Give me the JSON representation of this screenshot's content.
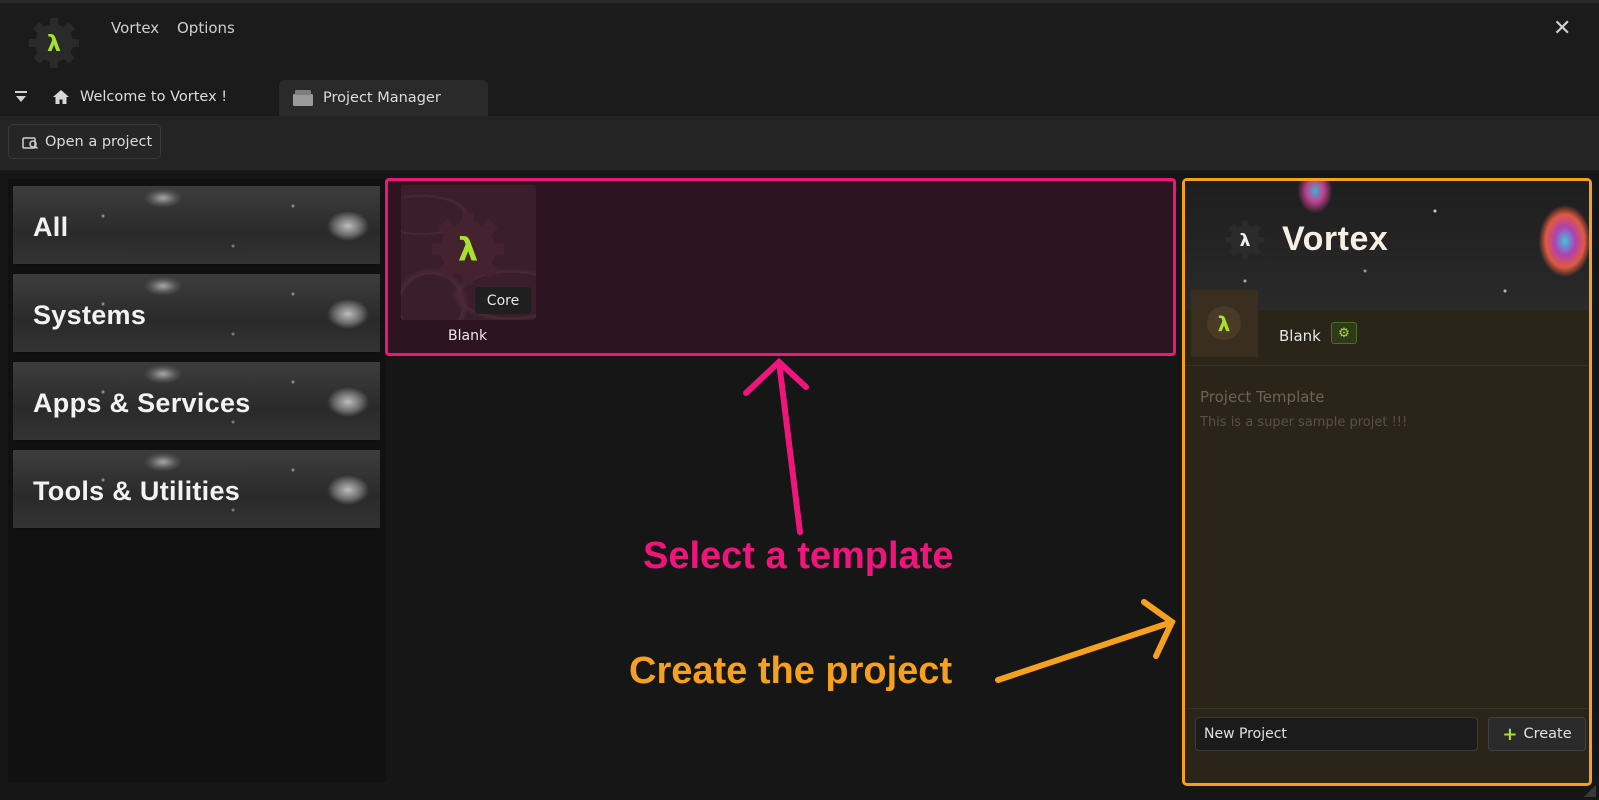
{
  "app": {
    "menu": [
      "Vortex",
      "Options"
    ]
  },
  "tabs": [
    {
      "label": "Welcome to Vortex !",
      "active": false
    },
    {
      "label": "Project Manager",
      "active": true
    }
  ],
  "toolbar": {
    "open_project_label": "Open a project"
  },
  "categories": [
    "All",
    "Systems",
    "Apps & Services",
    "Tools & Utilities"
  ],
  "templates": [
    {
      "name": "Blank",
      "badge": "Core"
    }
  ],
  "details": {
    "banner_title": "Vortex",
    "selected_template": "Blank",
    "section_label": "Project Template",
    "description": "This is a super sample projet !!!",
    "project_name_value": "New Project",
    "create_label": "Create"
  },
  "annotations": {
    "select": "Select a template",
    "create": "Create the project"
  },
  "colors": {
    "accent_green": "#a6e22e",
    "annotation_pink": "#f0157d",
    "annotation_orange": "#f5a01e"
  }
}
